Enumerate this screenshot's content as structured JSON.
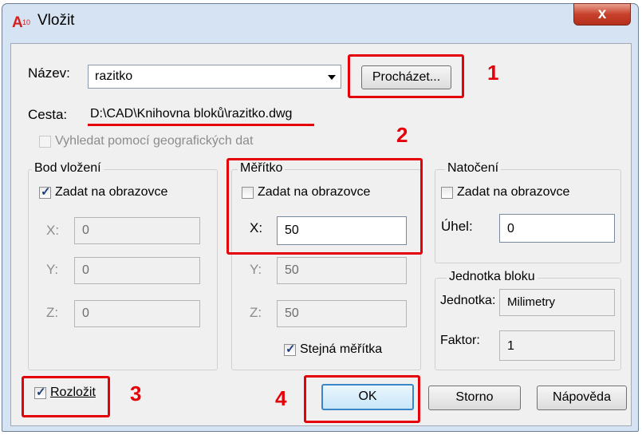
{
  "window": {
    "title": "Vložit",
    "close_glyph": "x",
    "icon_text": "A10"
  },
  "name_row": {
    "label": "Název:",
    "value": "razitko",
    "browse_label": "Procházet..."
  },
  "path_row": {
    "label": "Cesta:",
    "value": "D:\\CAD\\Knihovna bloků\\razitko.dwg"
  },
  "geo_checkbox": {
    "label": "Vyhledat pomocí geografických dat",
    "checked": false
  },
  "insertion": {
    "title": "Bod vložení",
    "on_screen_label": "Zadat na obrazovce",
    "on_screen_checked": true,
    "x_label": "X:",
    "x_value": "0",
    "y_label": "Y:",
    "y_value": "0",
    "z_label": "Z:",
    "z_value": "0"
  },
  "scale": {
    "title": "Měřítko",
    "on_screen_label": "Zadat na obrazovce",
    "on_screen_checked": false,
    "x_label": "X:",
    "x_value": "50",
    "y_label": "Y:",
    "y_value": "50",
    "z_label": "Z:",
    "z_value": "50",
    "uniform_label": "Stejná měřítka",
    "uniform_checked": true
  },
  "rotation": {
    "title": "Natočení",
    "on_screen_label": "Zadat na obrazovce",
    "on_screen_checked": false,
    "angle_label": "Úhel:",
    "angle_value": "0"
  },
  "block_unit": {
    "title": "Jednotka bloku",
    "unit_label": "Jednotka:",
    "unit_value": "Milimetry",
    "factor_label": "Faktor:",
    "factor_value": "1"
  },
  "explode": {
    "label": "Rozložit",
    "checked": true
  },
  "buttons": {
    "ok": "OK",
    "cancel": "Storno",
    "help": "Nápověda"
  },
  "annotations": {
    "n1": "1",
    "n2": "2",
    "n3": "3",
    "n4": "4",
    "color": "#e5000a"
  }
}
